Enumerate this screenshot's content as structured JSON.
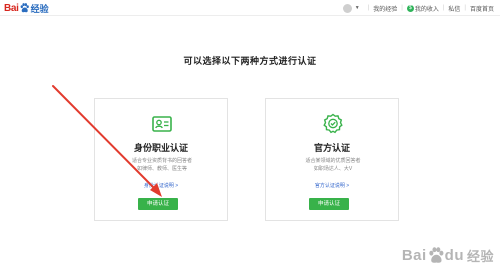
{
  "header": {
    "logo": {
      "text_bai": "Bai",
      "text_jingyan": "经验"
    },
    "links": [
      "我的经验",
      "我的收入",
      "私信",
      "百度首页"
    ],
    "money_symbol": "$"
  },
  "main": {
    "title": "可以选择以下两种方式进行认证",
    "cards": [
      {
        "title": "身份职业认证",
        "desc_line1": "适合专业资质背书的回答者",
        "desc_line2": "如律师、教师、医生等",
        "link": "身份认证说明 >",
        "button": "申请认证",
        "icon": "id-card-icon"
      },
      {
        "title": "官方认证",
        "desc_line1": "适合某领域的优质回答者",
        "desc_line2": "如职场达人、大V",
        "link": "官方认证说明 >",
        "button": "申请认证",
        "icon": "certificate-badge-icon"
      }
    ]
  },
  "watermark": {
    "text_bai": "Bai",
    "text_du": "du",
    "text_jingyan": "经验"
  },
  "colors": {
    "accent_green": "#38b24a",
    "link_blue": "#3366cc",
    "annotation_red": "#e23b2e",
    "logo_red": "#d7261e"
  }
}
